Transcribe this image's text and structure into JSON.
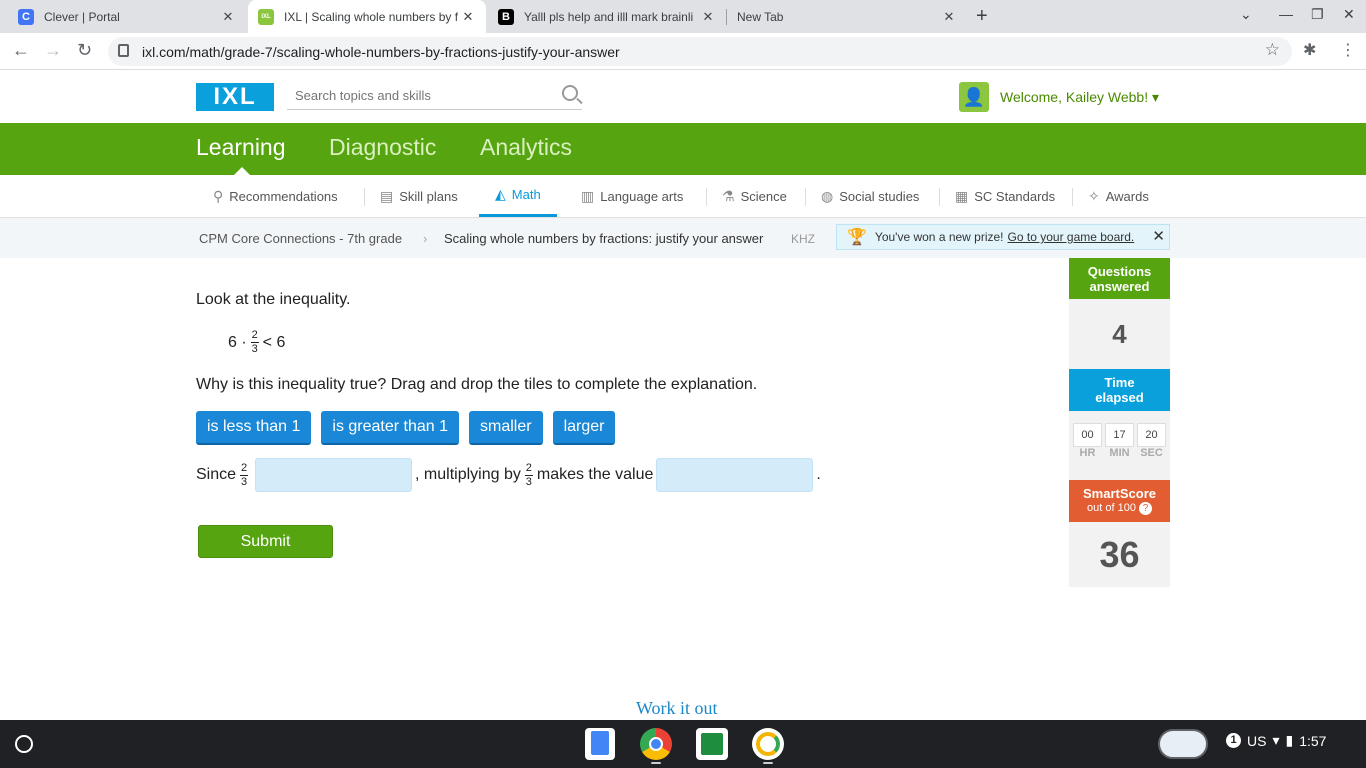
{
  "browser": {
    "tabs": [
      {
        "title": "Clever | Portal",
        "favicon": "C"
      },
      {
        "title": "IXL | Scaling whole numbers by f",
        "favicon": "IXL"
      },
      {
        "title": "Yalll pls help and illl mark brainli",
        "favicon": "B"
      },
      {
        "title": "New Tab",
        "favicon": ""
      }
    ],
    "url": "ixl.com/math/grade-7/scaling-whole-numbers-by-fractions-justify-your-answer"
  },
  "header": {
    "logo": "IXL",
    "search_placeholder": "Search topics and skills",
    "welcome": "Welcome, Kailey Webb!"
  },
  "main_nav": [
    "Learning",
    "Diagnostic",
    "Analytics"
  ],
  "sub_nav": [
    {
      "label": "Recommendations",
      "icon": "recommendations-icon"
    },
    {
      "label": "Skill plans",
      "icon": "skill-plans-icon"
    },
    {
      "label": "Math",
      "icon": "math-icon"
    },
    {
      "label": "Language arts",
      "icon": "book-icon"
    },
    {
      "label": "Science",
      "icon": "flask-icon"
    },
    {
      "label": "Social studies",
      "icon": "globe-icon"
    },
    {
      "label": "SC Standards",
      "icon": "standards-icon"
    },
    {
      "label": "Awards",
      "icon": "awards-icon"
    }
  ],
  "breadcrumb": {
    "course": "CPM Core Connections - 7th grade",
    "skill": "Scaling whole numbers by fractions: justify your answer",
    "code": "KHZ"
  },
  "prize": {
    "text": "You've won a new prize!",
    "link": "Go to your game board."
  },
  "question": {
    "prompt": "Look at the inequality.",
    "inequality": {
      "left": "6 ·",
      "num": "2",
      "den": "3",
      "right": "< 6"
    },
    "why": "Why is this inequality true? Drag and drop the tiles to complete the explanation.",
    "tiles": [
      "is less than 1",
      "is greater than 1",
      "smaller",
      "larger"
    ],
    "since": "Since",
    "mid": ", multiplying by",
    "end": "makes the value",
    "period": ".",
    "submit": "Submit"
  },
  "stats": {
    "answered_label_1": "Questions",
    "answered_label_2": "answered",
    "answered": "4",
    "time_label_1": "Time",
    "time_label_2": "elapsed",
    "hr": "00",
    "min": "17",
    "sec": "20",
    "hr_label": "HR",
    "min_label": "MIN",
    "sec_label": "SEC",
    "smartscore_label": "SmartScore",
    "smartscore_sub": "out of 100",
    "smartscore": "36"
  },
  "work_it_out": "Work it out",
  "system": {
    "locale": "US",
    "notifications": "1",
    "time": "1:57"
  },
  "colors": {
    "ixl_green": "#56a40f",
    "ixl_blue": "#0a9ad9",
    "tile_blue": "#1a88d6",
    "smartscore_orange": "#e25d31"
  }
}
